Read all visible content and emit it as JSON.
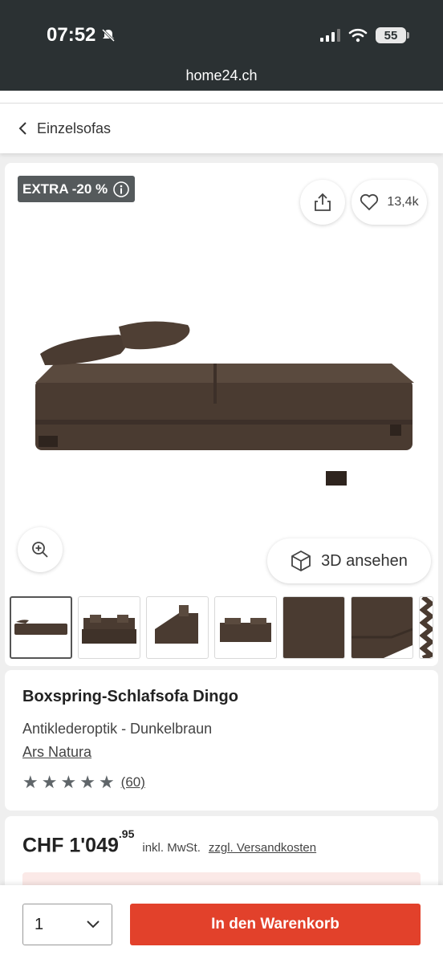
{
  "status": {
    "time": "07:52",
    "battery": "55"
  },
  "browser": {
    "url": "home24.ch"
  },
  "breadcrumb": {
    "label": "Einzelsofas"
  },
  "gallery": {
    "badge": "EXTRA -20 %",
    "favorites_count": "13,4k",
    "view3d_label": "3D ansehen",
    "thumbnails": [
      {
        "kind": "sofa-bed",
        "selected": true
      },
      {
        "kind": "sofa-front"
      },
      {
        "kind": "sofa-side"
      },
      {
        "kind": "sofa-front-low"
      },
      {
        "kind": "fabric-detail"
      },
      {
        "kind": "corner-detail"
      },
      {
        "kind": "partial"
      }
    ]
  },
  "product": {
    "title": "Boxspring-Schlafsofa Dingo",
    "subtitle": "Antiklederoptik - Dunkelbraun",
    "brand": "Ars Natura",
    "rating_stars": 5,
    "rating_count": "(60)"
  },
  "price": {
    "main": "CHF 1'049",
    "cents": ".95",
    "vat": "inkl. MwSt.",
    "shipping": "zzgl. Versandkosten"
  },
  "cart": {
    "quantity": "1",
    "button_label": "In den Warenkorb"
  },
  "colors": {
    "accent": "#e2412b",
    "statusbar": "#2b3133",
    "sofa": "#4a3b31"
  }
}
